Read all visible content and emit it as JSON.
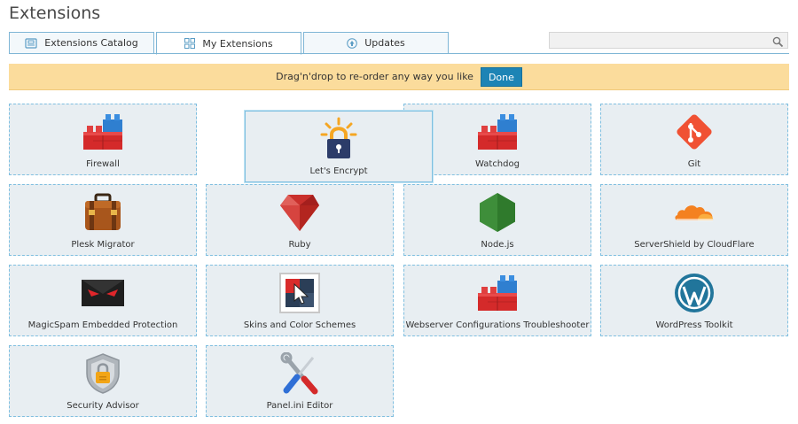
{
  "page": {
    "title": "Extensions"
  },
  "tabs": [
    {
      "label": "Extensions Catalog",
      "icon": "catalog-icon"
    },
    {
      "label": "My Extensions",
      "icon": "grid-icon"
    },
    {
      "label": "Updates",
      "icon": "update-icon"
    }
  ],
  "search": {
    "placeholder": ""
  },
  "banner": {
    "message": "Drag'n'drop to re-order any way you like",
    "done_label": "Done"
  },
  "extensions": [
    {
      "label": "Firewall",
      "icon": "lego-bricks-icon"
    },
    {
      "label": "Let's Encrypt",
      "icon": "lock-icon",
      "state": "dragging"
    },
    {
      "label": "Watchdog",
      "icon": "lego-bricks-icon"
    },
    {
      "label": "Git",
      "icon": "git-icon"
    },
    {
      "label": "Plesk Migrator",
      "icon": "suitcase-icon"
    },
    {
      "label": "Ruby",
      "icon": "ruby-icon"
    },
    {
      "label": "Node.js",
      "icon": "nodejs-icon"
    },
    {
      "label": "ServerShield by CloudFlare",
      "icon": "cloudflare-icon"
    },
    {
      "label": "MagicSpam Embedded Protection",
      "icon": "magicspam-icon"
    },
    {
      "label": "Skins and Color Schemes",
      "icon": "skins-icon"
    },
    {
      "label": "Webserver Configurations Troubleshooter",
      "icon": "lego-bricks-icon"
    },
    {
      "label": "WordPress Toolkit",
      "icon": "wordpress-icon"
    },
    {
      "label": "Security Advisor",
      "icon": "shield-lock-icon"
    },
    {
      "label": "Panel.ini Editor",
      "icon": "tools-icon"
    }
  ],
  "colors": {
    "accent": "#1d84b5",
    "banner": "#fbdc9c",
    "card_border": "#7fbfe0",
    "card_bg": "#e8eef2"
  }
}
